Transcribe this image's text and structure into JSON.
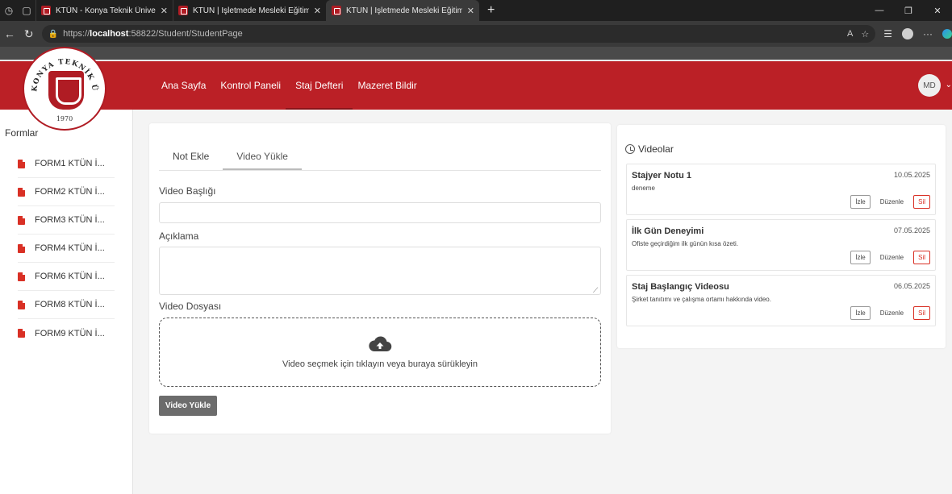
{
  "browser": {
    "tabs": [
      {
        "title": "KTÜN - Konya Teknik Üniversitesi",
        "active": false
      },
      {
        "title": "KTUN | İşletmede Mesleki Eğitim",
        "active": false
      },
      {
        "title": "KTUN | İşletmede Mesleki Eğitim",
        "active": true
      }
    ],
    "url_scheme": "https://",
    "url_host": "localhost",
    "url_path": ":58822/Student/StudentPage"
  },
  "header": {
    "logo_text": "KONYA TEKNİK ÜNİVERSİTESİ",
    "logo_year": "1970",
    "nav": [
      "Ana Sayfa",
      "Kontrol Paneli",
      "Staj Defteri",
      "Mazeret Bildir"
    ],
    "active_nav": "Staj Defteri",
    "user_initials": "MD",
    "accent_color": "#bb2026"
  },
  "sidebar": {
    "title": "Formlar",
    "items": [
      "FORM1 KTÜN İ...",
      "FORM2 KTÜN İ...",
      "FORM3 KTÜN İ...",
      "FORM4 KTÜN İ...",
      "FORM6 KTÜN İ...",
      "FORM8 KTÜN İ...",
      "FORM9 KTÜN İ..."
    ]
  },
  "form": {
    "tabs": [
      "Not Ekle",
      "Video Yükle"
    ],
    "active_tab": "Video Yükle",
    "title_label": "Video Başlığı",
    "title_value": "",
    "desc_label": "Açıklama",
    "desc_value": "",
    "file_label": "Video Dosyası",
    "dropzone_hint": "Video seçmek için tıklayın veya buraya sürükleyin",
    "submit_label": "Video Yükle"
  },
  "videos": {
    "title": "Videolar",
    "items": [
      {
        "title": "Stajyer Notu 1",
        "date": "10.05.2025",
        "desc": "deneme"
      },
      {
        "title": "İlk Gün Deneyimi",
        "date": "07.05.2025",
        "desc": "Ofiste geçirdiğim ilk günün kısa özeti."
      },
      {
        "title": "Staj Başlangıç Videosu",
        "date": "06.05.2025",
        "desc": "Şirket tanıtımı ve çalışma ortamı hakkında video."
      }
    ],
    "actions": {
      "watch": "İzle",
      "edit": "Düzenle",
      "delete": "Sil"
    }
  }
}
